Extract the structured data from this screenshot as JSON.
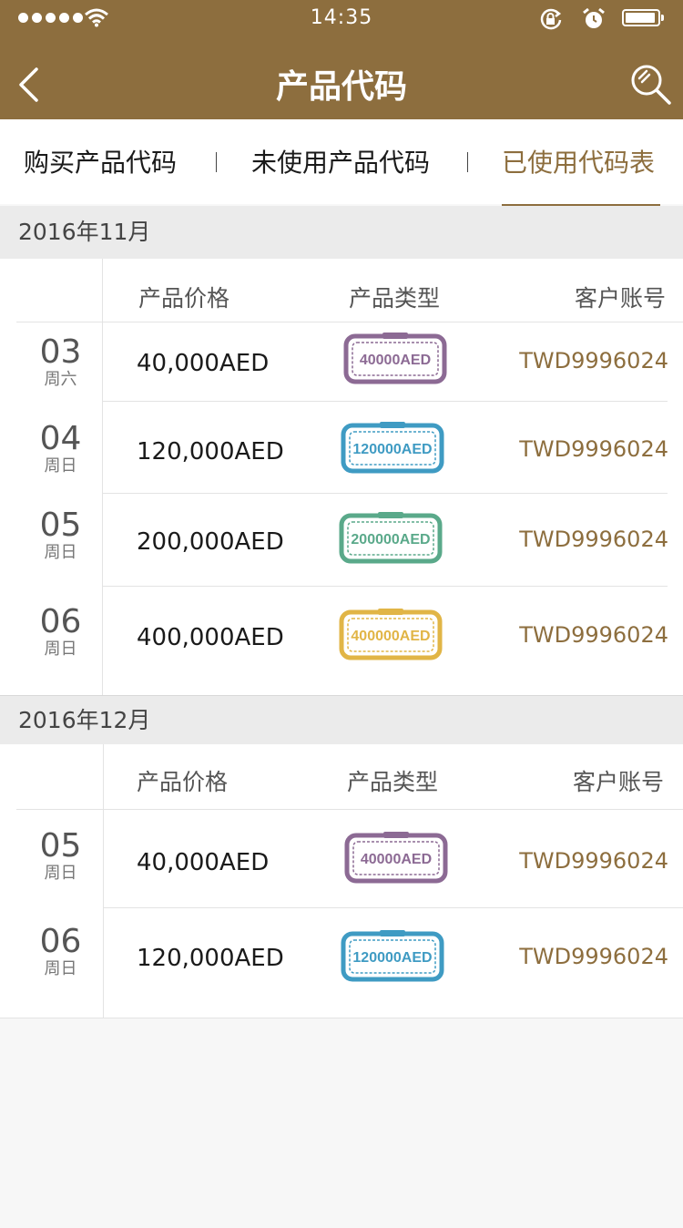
{
  "status": {
    "time": "14:35"
  },
  "nav": {
    "title": "产品代码"
  },
  "tabs": [
    {
      "label": "购买产品代码"
    },
    {
      "label": "未使用产品代码"
    },
    {
      "label": "已使用代码表"
    }
  ],
  "columns": {
    "price": "产品价格",
    "type": "产品类型",
    "account": "客户账号"
  },
  "sections": [
    {
      "month": "2016年11月",
      "rows": [
        {
          "day": "03",
          "weekday": "周六",
          "price": "40,000AED",
          "ticket": "40000AED",
          "color": "#8c6a94",
          "account": "TWD9996024"
        },
        {
          "day": "04",
          "weekday": "周日",
          "price": "120,000AED",
          "ticket": "120000AED",
          "color": "#3f9bc3",
          "account": "TWD9996024"
        },
        {
          "day": "05",
          "weekday": "周日",
          "price": "200,000AED",
          "ticket": "200000AED",
          "color": "#5aa98a",
          "account": "TWD9996024"
        },
        {
          "day": "06",
          "weekday": "周日",
          "price": "400,000AED",
          "ticket": "400000AED",
          "color": "#e1b546",
          "account": "TWD9996024"
        }
      ]
    },
    {
      "month": "2016年12月",
      "rows": [
        {
          "day": "05",
          "weekday": "周日",
          "price": "40,000AED",
          "ticket": "40000AED",
          "color": "#8c6a94",
          "account": "TWD9996024"
        },
        {
          "day": "06",
          "weekday": "周日",
          "price": "120,000AED",
          "ticket": "120000AED",
          "color": "#3f9bc3",
          "account": "TWD9996024"
        }
      ]
    }
  ],
  "theme": {
    "brand": "#8d6e3e",
    "background": "#f7f7f7",
    "divider": "#e3e3e3"
  }
}
